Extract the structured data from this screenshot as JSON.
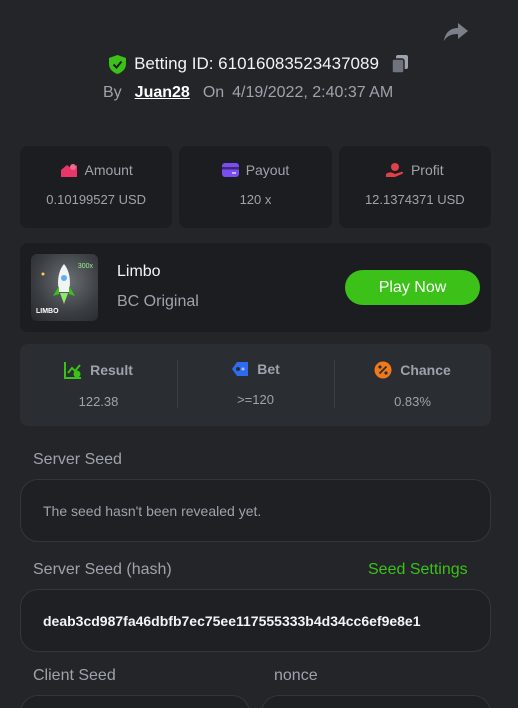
{
  "header": {
    "bet_id_label": "Betting ID: 61016083523437089",
    "by_label": "By",
    "username": "Juan28",
    "on_label": "On",
    "date": "4/19/2022, 2:40:37 AM"
  },
  "stats": {
    "amount": {
      "label": "Amount",
      "value": "0.10199527 USD"
    },
    "payout": {
      "label": "Payout",
      "value": "120 x"
    },
    "profit": {
      "label": "Profit",
      "value": "12.1374371 USD"
    }
  },
  "game": {
    "title": "Limbo",
    "subtitle": "BC Original",
    "play_label": "Play Now",
    "thumb_label": "LIMBO",
    "thumb_mult": "300x"
  },
  "result": {
    "result": {
      "label": "Result",
      "value": "122.38"
    },
    "bet": {
      "label": "Bet",
      "value": ">=120"
    },
    "chance": {
      "label": "Chance",
      "value": "0.83%"
    }
  },
  "server_seed": {
    "label": "Server Seed",
    "value": "The seed hasn't been revealed yet."
  },
  "server_seed_hash": {
    "label": "Server Seed (hash)",
    "settings_label": "Seed Settings",
    "value": "deab3cd987fa46dbfb7ec75ee117555333b4d34cc6ef9e8e1"
  },
  "client_seed": {
    "label": "Client Seed"
  },
  "nonce": {
    "label": "nonce"
  },
  "colors": {
    "accent": "#3bc117",
    "amount_icon": "#e8366b",
    "payout_icon": "#7b4df0",
    "profit_icon": "#e0404a"
  }
}
